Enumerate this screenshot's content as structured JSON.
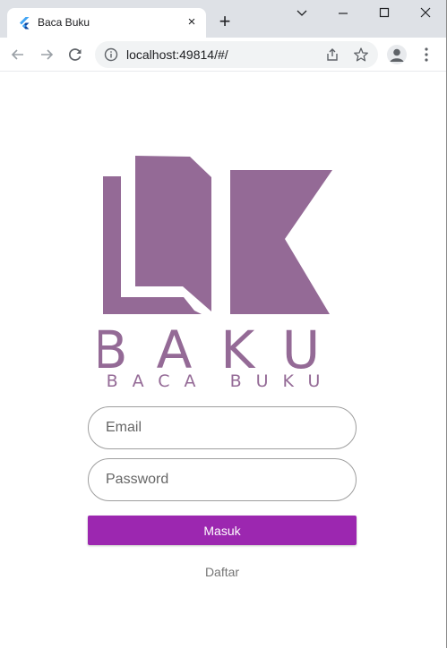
{
  "browser": {
    "tab_title": "Baca Buku",
    "tab_close": "×",
    "new_tab": "+",
    "url": "localhost:49814/#/",
    "icons": {
      "favicon": "flutter-icon",
      "back": "arrow-left-icon",
      "forward": "arrow-right-icon",
      "reload": "reload-icon",
      "info": "info-icon",
      "share": "share-icon",
      "bookmark": "star-icon",
      "profile": "profile-icon",
      "menu": "more-vert-icon"
    }
  },
  "logo": {
    "wordmark": "BAKU",
    "tagline": "BACA BUKU",
    "color": "#946a96"
  },
  "form": {
    "email_placeholder": "Email",
    "password_placeholder": "Password",
    "submit_label": "Masuk",
    "register_label": "Daftar",
    "accent_color": "#9c27b0"
  }
}
